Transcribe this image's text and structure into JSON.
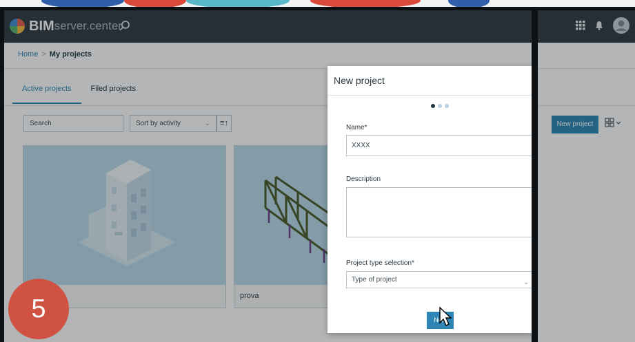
{
  "navbar": {
    "logo_bold": "BIM",
    "logo_light": "server.center",
    "icons": [
      "search-icon",
      "apps-grid-icon",
      "notification-bell-icon",
      "user-avatar-icon"
    ]
  },
  "breadcrumb": {
    "home": "Home",
    "separator": ">",
    "current": "My projects"
  },
  "tabs": [
    {
      "label": "Active projects",
      "active": true
    },
    {
      "label": "Filed projects",
      "active": false
    }
  ],
  "toolbar": {
    "search_placeholder": "Search",
    "sort_value": "Sort by activity",
    "new_project_label": "New project"
  },
  "projects": [
    {
      "name": ""
    },
    {
      "name": "prova"
    }
  ],
  "modal": {
    "title": "New project",
    "steps_total": 3,
    "step_current": 1,
    "name_label": "Name*",
    "name_value": "XXXX",
    "description_label": "Description",
    "description_value": "",
    "project_type_label": "Project type selection*",
    "project_type_value": "Type of project",
    "next_label": "Next"
  },
  "overlay_badge": "5",
  "colors": {
    "navbar": "#2e3a42",
    "accent": "#2f86b5",
    "badge": "#cf5242",
    "card_bg": "#b9dbea"
  }
}
